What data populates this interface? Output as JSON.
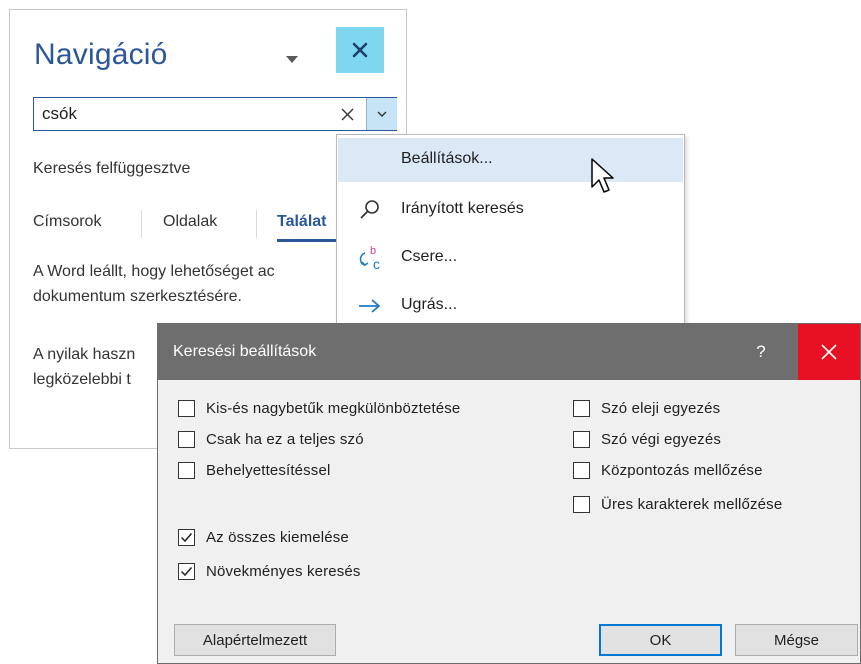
{
  "nav": {
    "title": "Navigáció",
    "search_value": "csók",
    "status": "Keresés felfüggesztve",
    "tabs": [
      "Címsorok",
      "Oldalak",
      "Találat"
    ],
    "message_lines": [
      "A Word leállt, hogy lehetőséget ac",
      "dokumentum szerkesztésére.",
      "A nyilak haszn",
      "legközelebbi t"
    ],
    "accent_color": "#2b579a",
    "close_bg": "#7ed7ee"
  },
  "menu": {
    "items": [
      {
        "label": "Beállítások...",
        "icon": "none",
        "highlighted": true
      },
      {
        "label": "Irányított keresés",
        "icon": "search-icon"
      },
      {
        "label": "Csere...",
        "icon": "replace-icon"
      },
      {
        "label": "Ugrás...",
        "icon": "arrow-right-icon"
      }
    ]
  },
  "dialog": {
    "title": "Keresési beállítások",
    "help": "?",
    "left_options": [
      {
        "label": "Kis-és nagybetűk megkülönböztetése",
        "checked": false
      },
      {
        "label": "Csak ha ez a teljes szó",
        "checked": false
      },
      {
        "label": "Behelyettesítéssel",
        "checked": false
      },
      {
        "label": "Az összes kiemelése",
        "checked": true
      },
      {
        "label": "Növekményes keresés",
        "checked": true
      }
    ],
    "right_options": [
      {
        "label": "Szó eleji egyezés",
        "checked": false
      },
      {
        "label": "Szó végi egyezés",
        "checked": false
      },
      {
        "label": "Központozás mellőzése",
        "checked": false
      },
      {
        "label": "Üres karakterek mellőzése",
        "checked": false
      }
    ],
    "buttons": {
      "default": "Alapértelmezett",
      "ok": "OK",
      "cancel": "Mégse"
    },
    "close_color": "#e81123",
    "titlebar_color": "#6e6e6e"
  }
}
